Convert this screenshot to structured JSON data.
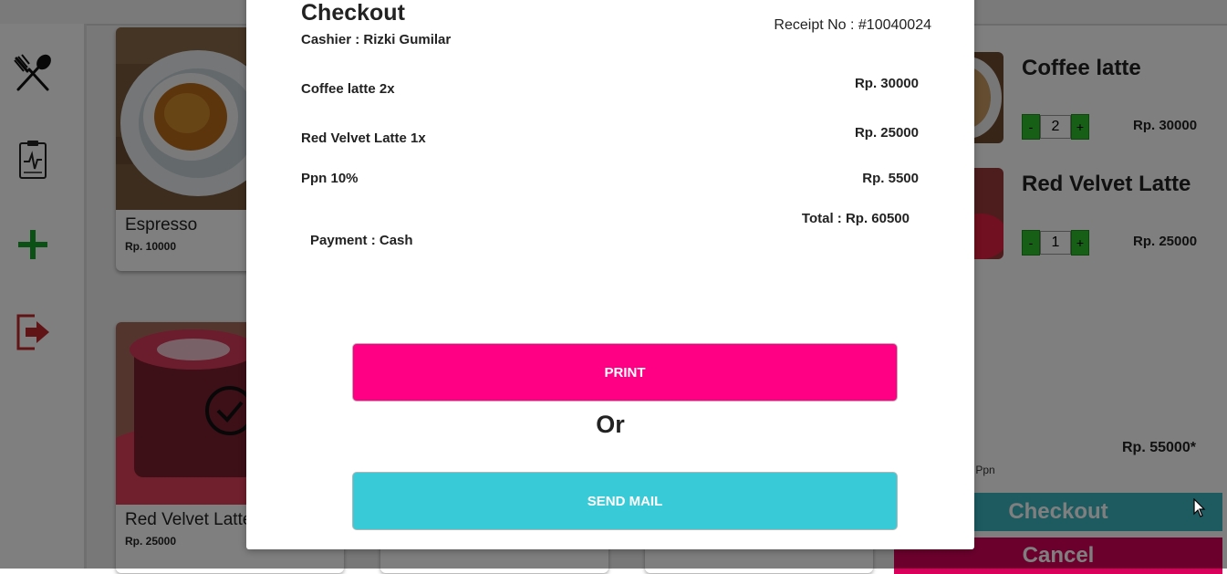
{
  "menu": [
    {
      "name": "Espresso",
      "price": "Rp. 10000"
    },
    {
      "name": "Red Velvet Latte",
      "price": "Rp. 25000"
    }
  ],
  "cart": {
    "items": [
      {
        "name": "Coffee latte",
        "qty": "2",
        "price": "Rp. 30000",
        "minus": "-",
        "plus": "+"
      },
      {
        "name": "Red Velvet Latte",
        "qty": "1",
        "price": "Rp. 25000",
        "minus": "-",
        "plus": "+"
      }
    ],
    "subtotal": "Rp. 55000*",
    "ppn_note": "k Ppn",
    "checkout_label": "Checkout",
    "cancel_label": "Cancel"
  },
  "modal": {
    "title": "Checkout",
    "cashier": "Cashier : Rizki Gumilar",
    "receipt": "Receipt No : #10040024",
    "lines": [
      {
        "label": "Coffee latte 2x",
        "value": "Rp. 30000"
      },
      {
        "label": "Red Velvet Latte 1x",
        "value": "Rp. 25000"
      },
      {
        "label": "Ppn 10%",
        "value": "Rp. 5500"
      }
    ],
    "total": "Total : Rp. 60500",
    "payment": "Payment : Cash",
    "print_label": "PRINT",
    "or_label": "Or",
    "mail_label": "SEND MAIL"
  },
  "colors": {
    "print": "#ff0085",
    "mail": "#38cbd7",
    "checkout": "#3ab7c3",
    "cancel": "#d8005a",
    "qty_button": "#2fbf2f"
  }
}
